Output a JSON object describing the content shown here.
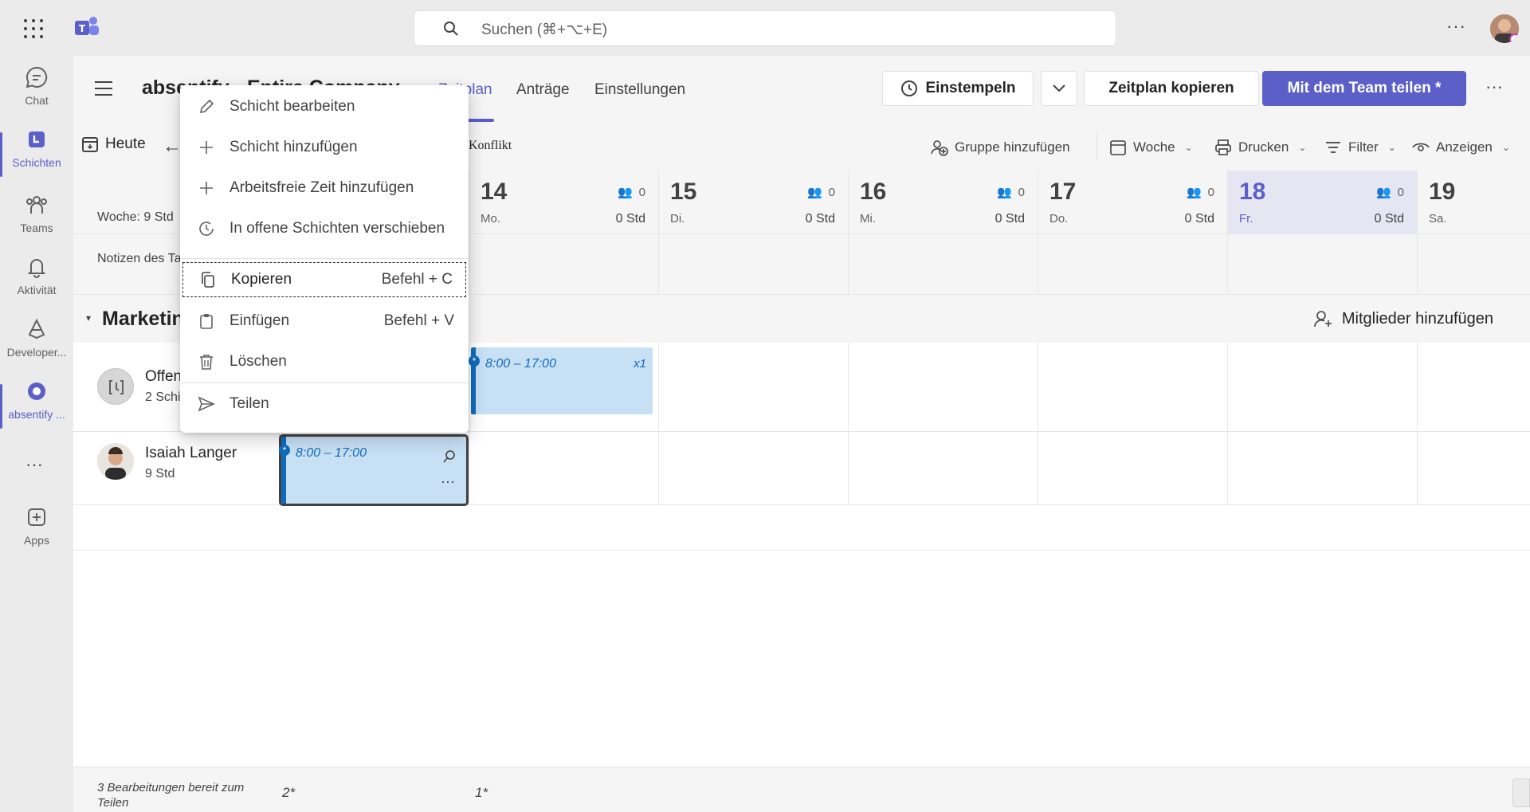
{
  "search": {
    "placeholder": "Suchen (⌘+⌥+E)"
  },
  "rail": {
    "items": [
      {
        "label": "Chat",
        "icon": "chat-icon"
      },
      {
        "label": "Schichten",
        "icon": "shifts-icon",
        "active": true
      },
      {
        "label": "Teams",
        "icon": "teams-icon"
      },
      {
        "label": "Aktivität",
        "icon": "bell-icon"
      },
      {
        "label": "Developer...",
        "icon": "developer-icon"
      },
      {
        "label": "absentify ...",
        "icon": "absentify-icon"
      },
      {
        "label": "Apps",
        "icon": "apps-icon"
      }
    ]
  },
  "header": {
    "team_title": "absentify - Entire Company",
    "tabs": [
      "Zeitplan",
      "Anträge",
      "Einstellungen"
    ],
    "clock_in": "Einstempeln",
    "copy_schedule": "Zeitplan kopieren",
    "share": "Mit dem Team teilen *"
  },
  "toolbar": {
    "today": "Heute",
    "conflict": "Konflikt",
    "add_group": "Gruppe hinzufügen",
    "view": "Woche",
    "print": "Drucken",
    "filter": "Filter",
    "display": "Anzeigen"
  },
  "week": {
    "label": "Woche: 9 Std",
    "days": [
      {
        "num": "14",
        "wd": "Mo.",
        "count": "0",
        "hours": "0 Std"
      },
      {
        "num": "15",
        "wd": "Di.",
        "count": "0",
        "hours": "0 Std"
      },
      {
        "num": "16",
        "wd": "Mi.",
        "count": "0",
        "hours": "0 Std"
      },
      {
        "num": "17",
        "wd": "Do.",
        "count": "0",
        "hours": "0 Std"
      },
      {
        "num": "18",
        "wd": "Fr.",
        "count": "0",
        "hours": "0 Std",
        "today": true
      },
      {
        "num": "19",
        "wd": "Sa."
      }
    ]
  },
  "notes_label": "Notizen des Tages",
  "group": {
    "name": "Marketing",
    "add_members": "Mitglieder hinzufügen"
  },
  "rows": {
    "open_shifts": {
      "name": "Offene Schichten",
      "sub": "2 Schichten"
    },
    "person": {
      "name": "Isaiah Langer",
      "sub": "9 Std"
    }
  },
  "shifts": {
    "open_shift_time": "8:00 – 17:00",
    "open_shift_count": "x1",
    "person_shift_time": "8:00 – 17:00"
  },
  "footer": {
    "edits": "3 Bearbeitungen bereit zum Teilen",
    "col1": "2*",
    "col2": "1*"
  },
  "context_menu": {
    "items": [
      {
        "label": "Schicht bearbeiten",
        "icon": "pencil-icon"
      },
      {
        "label": "Schicht hinzufügen",
        "icon": "plus-icon"
      },
      {
        "label": "Arbeitsfreie Zeit hinzufügen",
        "icon": "plus-icon"
      },
      {
        "label": "In offene Schichten verschieben",
        "icon": "clock-arrow-icon"
      },
      {
        "label": "Kopieren",
        "shortcut": "Befehl + C",
        "icon": "copy-icon",
        "focused": true
      },
      {
        "label": "Einfügen",
        "shortcut": "Befehl + V",
        "icon": "paste-icon"
      },
      {
        "label": "Löschen",
        "icon": "trash-icon"
      },
      {
        "label": "Teilen",
        "icon": "send-icon"
      }
    ]
  },
  "colors": {
    "accent": "#5b5fc7",
    "shift_fill": "#c7e0f4",
    "shift_border": "#0f6cbd"
  }
}
